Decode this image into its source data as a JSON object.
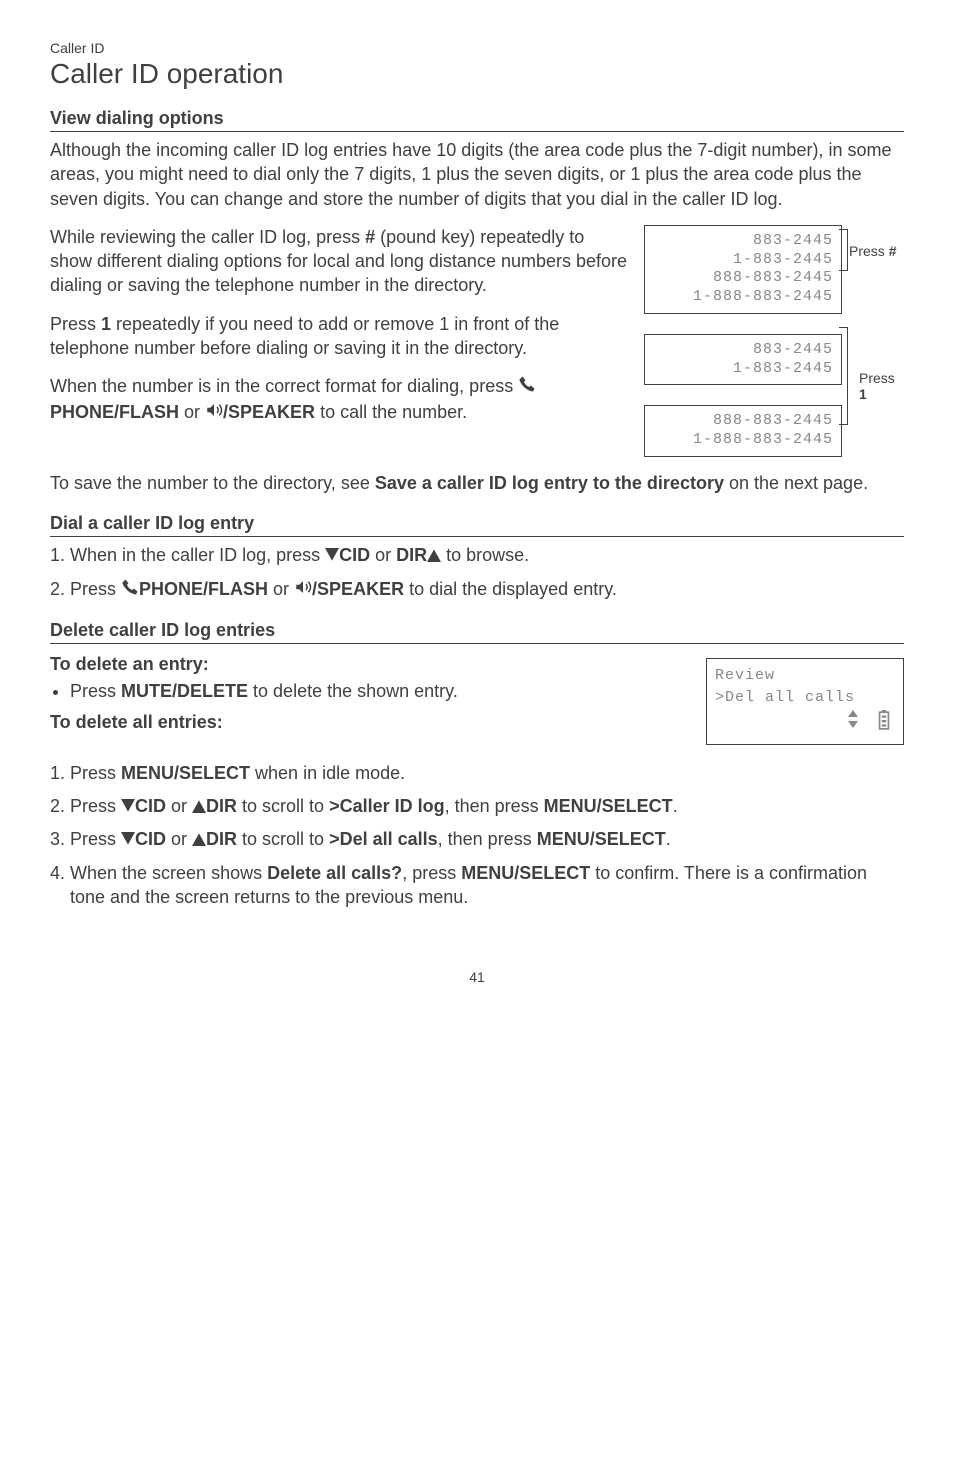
{
  "breadcrumb": "Caller ID",
  "title": "Caller ID operation",
  "sections": {
    "view_dialing": {
      "heading": "View dialing options",
      "para1": "Although the incoming caller ID log entries have 10 digits (the area code plus the 7-digit number), in some areas, you might need to dial only the 7 digits, 1 plus the seven digits, or 1 plus the area code plus the seven digits. You can change and store the number of digits that you dial in the caller ID log.",
      "para2_a": "While reviewing the caller ID log, press ",
      "para2_b": " (pound key) repeatedly to show different dialing options for local and long distance numbers before dialing or saving the telephone number in the directory.",
      "pound_key": "#",
      "para3_a": "Press ",
      "para3_b": " repeatedly if you need to add or remove 1 in front of the telephone number before dialing or saving it in the directory.",
      "one_key": "1",
      "para4_a": "When the number is in the correct format for dialing, press ",
      "phone_flash": "PHONE/",
      "flash_sc": "FLASH",
      "or_word": " or ",
      "speaker": "/SPEAKER",
      "para4_b": " to call the number.",
      "para5_a": "To save the number to the directory, see ",
      "para5_bold": "Save a caller ID log entry to the directory",
      "para5_b": " on the next page.",
      "screen1": "883-2445\n1-883-2445\n888-883-2445\n1-888-883-2445",
      "screen2": "883-2445\n1-883-2445",
      "screen3": "888-883-2445\n1-888-883-2445",
      "press_pound_label_a": "Press ",
      "press_pound_label_b": "#",
      "press_one_label_a": "Press ",
      "press_one_label_b": "1"
    },
    "dial_entry": {
      "heading": "Dial a caller ID log entry",
      "step1_a": "When in the caller ID log, press ",
      "cid_sc": "CID",
      "step1_b": " or ",
      "dir_sc": "DIR",
      "step1_c": " to browse.",
      "step2_a": "Press ",
      "step2_b": " to dial the displayed entry."
    },
    "delete": {
      "heading": "Delete caller ID log entries",
      "sub1": "To delete an entry:",
      "bullet1_a": "Press ",
      "mute_sc": "MUTE",
      "delete": "/DELETE",
      "bullet1_b": " to delete the shown entry.",
      "sub2": "To delete all entries:",
      "s1_a": "Press ",
      "menu": "MENU/",
      "select_sc": "SELECT",
      "s1_b": " when in idle mode.",
      "s2_a": "Press ",
      "s2_b": " or ",
      "s2_c": " to scroll to ",
      "caller_id_log": ">Caller ID log",
      "s2_d": ", then press ",
      "menu_sc": "MENU",
      "select": "/SELECT",
      "period": ".",
      "s3_c": " to scroll to ",
      "del_all": ">Del all calls",
      "s4_a": "When the screen shows ",
      "delete_all_q": "Delete all calls?",
      "s4_b": ", press ",
      "s4_c": " to confirm. There is a confirmation tone and the screen returns to the previous menu.",
      "review_line1": "Review",
      "review_line2": ">Del all calls"
    }
  },
  "page_number": "41"
}
